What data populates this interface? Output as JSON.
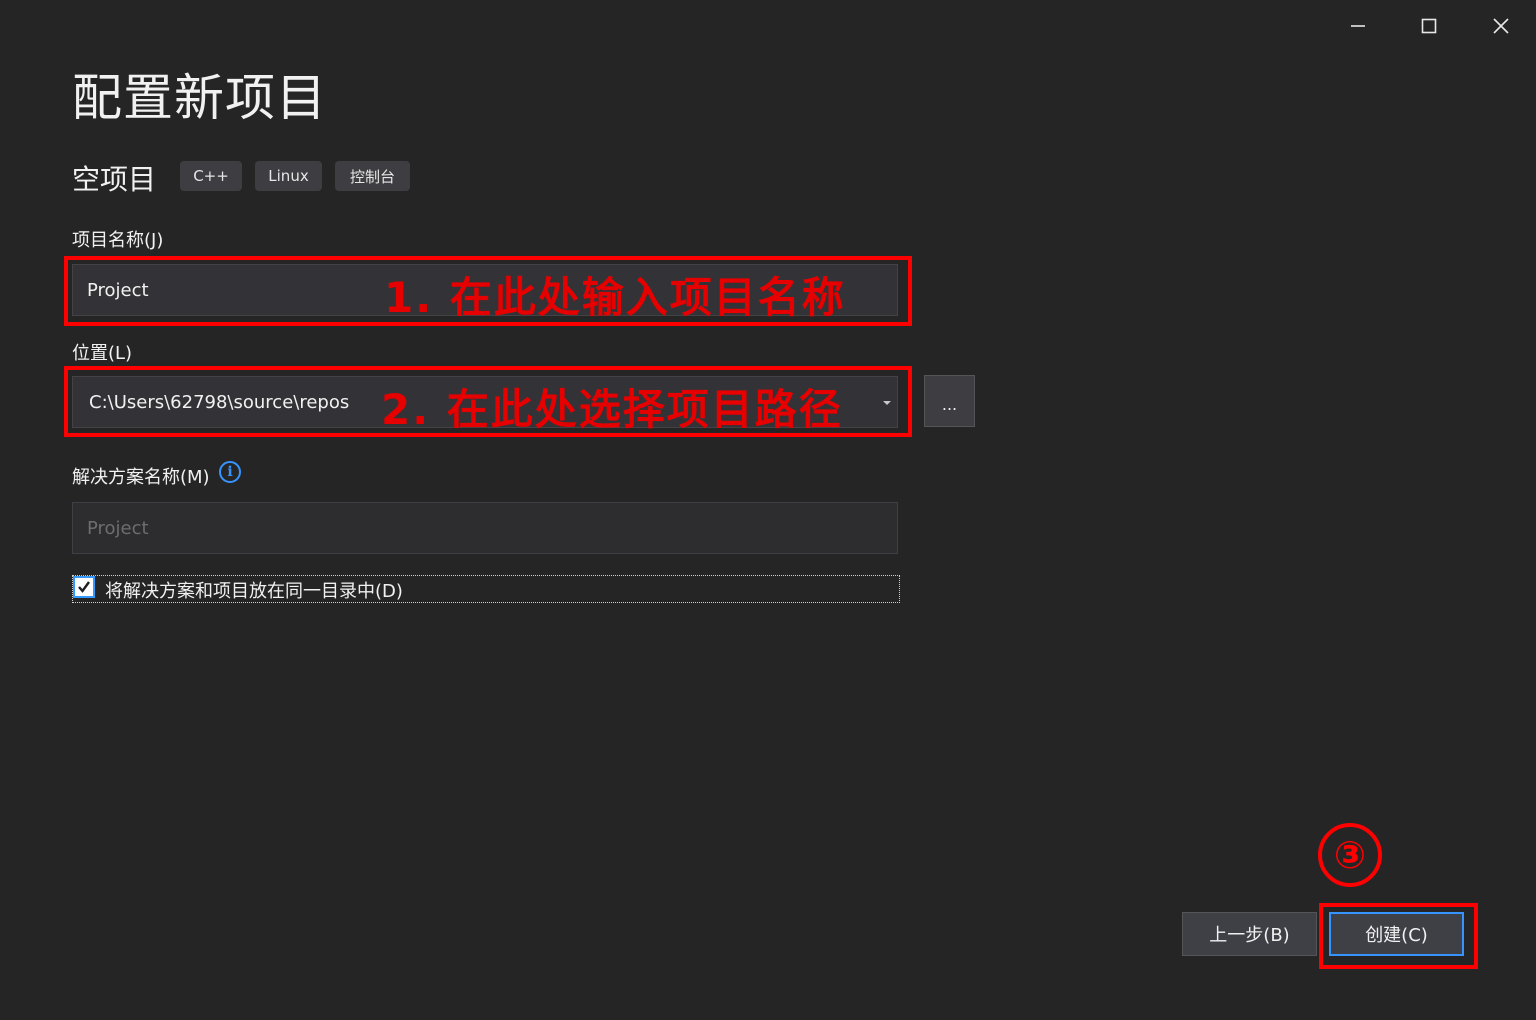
{
  "window": {
    "controls": [
      "minimize-icon",
      "maximize-icon",
      "close-icon"
    ]
  },
  "header": {
    "title": "配置新项目"
  },
  "template": {
    "name": "空项目",
    "tags": [
      "C++",
      "Linux",
      "控制台"
    ]
  },
  "fields": {
    "project_name": {
      "label": "项目名称(J)",
      "value": "Project"
    },
    "location": {
      "label": "位置(L)",
      "value": "C:\\Users\\62798\\source\\repos",
      "browse_label": "..."
    },
    "solution_name": {
      "label": "解决方案名称(M)",
      "placeholder": "Project",
      "info_glyph": "i"
    },
    "same_dir": {
      "checked": true,
      "label": "将解决方案和项目放在同一目录中(D)"
    }
  },
  "annotations": {
    "step1": "1. 在此处输入项目名称",
    "step2": "2. 在此处选择项目路径",
    "step3": "③",
    "color": "#ff0000"
  },
  "footer": {
    "back_label": "上一步(B)",
    "create_label": "创建(C)"
  },
  "colors": {
    "background": "#252526",
    "accent": "#3794ff"
  }
}
